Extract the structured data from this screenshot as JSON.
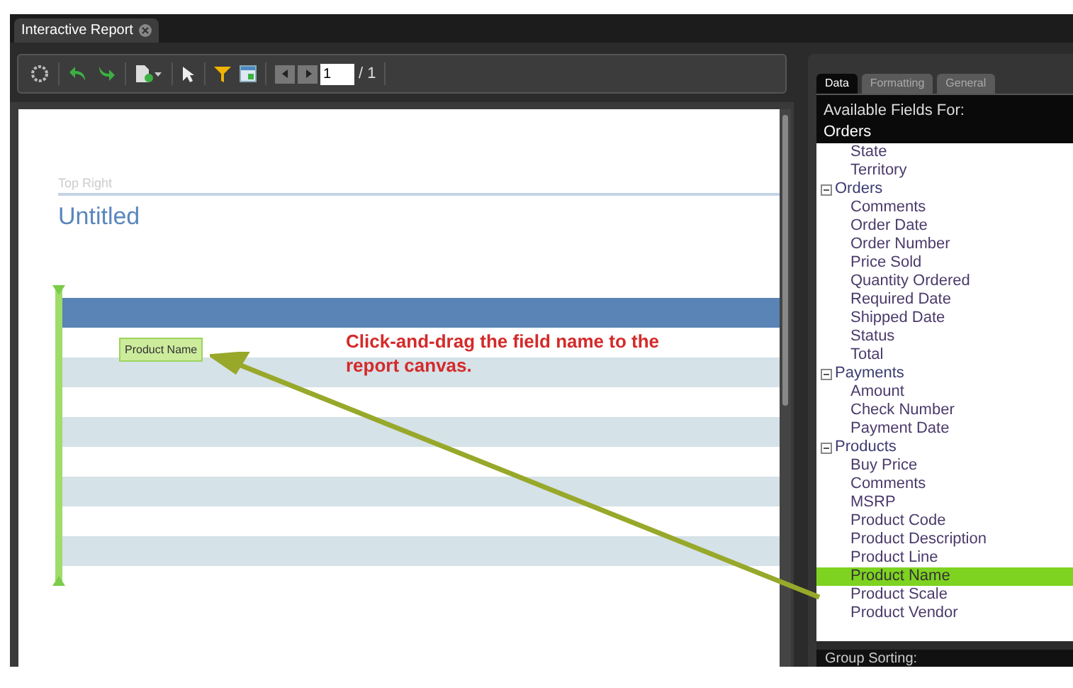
{
  "window": {
    "tabs": [
      {
        "title": "Interactive Report",
        "selected": true
      }
    ]
  },
  "toolbar": {
    "page_input": "1",
    "page_total": "/ 1"
  },
  "canvas": {
    "header_label": "Top Right",
    "title": "Untitled",
    "field_chip": "Product Name"
  },
  "annotation": "Click-and-drag the field name to the report canvas.",
  "panel": {
    "tabs": [
      {
        "label": "Data",
        "selected": true
      },
      {
        "label": "Formatting",
        "selected": false
      },
      {
        "label": "General",
        "selected": false
      }
    ],
    "header": "Available Fields For:",
    "source": "Orders",
    "tree": [
      {
        "label": "State",
        "kind": "field",
        "selected": false
      },
      {
        "label": "Territory",
        "kind": "field",
        "selected": false
      },
      {
        "label": "Orders",
        "kind": "group",
        "expanded": true,
        "children": [
          {
            "label": "Comments",
            "kind": "field",
            "selected": false
          },
          {
            "label": "Order Date",
            "kind": "field",
            "selected": false
          },
          {
            "label": "Order Number",
            "kind": "field",
            "selected": false
          },
          {
            "label": "Price Sold",
            "kind": "field",
            "selected": false
          },
          {
            "label": "Quantity Ordered",
            "kind": "field",
            "selected": false
          },
          {
            "label": "Required Date",
            "kind": "field",
            "selected": false
          },
          {
            "label": "Shipped Date",
            "kind": "field",
            "selected": false
          },
          {
            "label": "Status",
            "kind": "field",
            "selected": false
          },
          {
            "label": "Total",
            "kind": "field",
            "selected": false
          }
        ]
      },
      {
        "label": "Payments",
        "kind": "group",
        "expanded": true,
        "children": [
          {
            "label": "Amount",
            "kind": "field",
            "selected": false
          },
          {
            "label": "Check Number",
            "kind": "field",
            "selected": false
          },
          {
            "label": "Payment Date",
            "kind": "field",
            "selected": false
          }
        ]
      },
      {
        "label": "Products",
        "kind": "group",
        "expanded": true,
        "children": [
          {
            "label": "Buy Price",
            "kind": "field",
            "selected": false
          },
          {
            "label": "Comments",
            "kind": "field",
            "selected": false
          },
          {
            "label": "MSRP",
            "kind": "field",
            "selected": false
          },
          {
            "label": "Product Code",
            "kind": "field",
            "selected": false
          },
          {
            "label": "Product Description",
            "kind": "field",
            "selected": false
          },
          {
            "label": "Product Line",
            "kind": "field",
            "selected": false
          },
          {
            "label": "Product Name",
            "kind": "field",
            "selected": true
          },
          {
            "label": "Product Scale",
            "kind": "field",
            "selected": false
          },
          {
            "label": "Product Vendor",
            "kind": "field",
            "selected": false
          }
        ]
      }
    ],
    "footer": "Group Sorting:"
  }
}
